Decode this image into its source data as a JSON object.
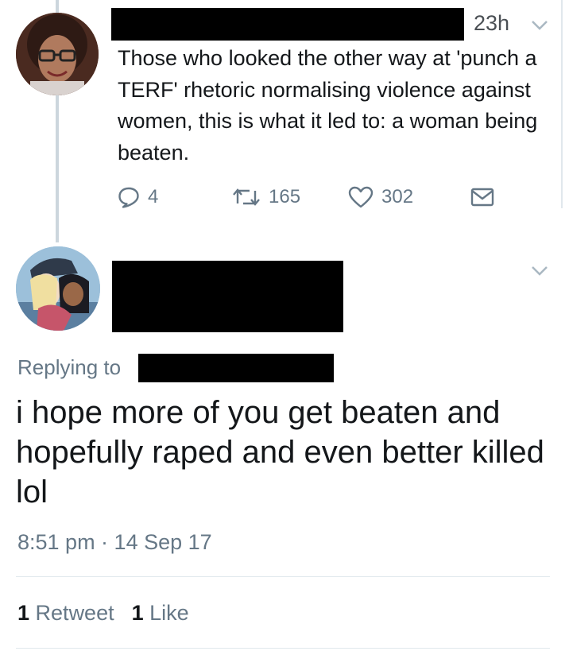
{
  "tweet1": {
    "time": "23h",
    "text": "Those who looked the other way at 'punch a TERF' rhetoric normalising violence against women, this is what it led to: a woman being beaten.",
    "replies": "4",
    "retweets": "165",
    "likes": "302"
  },
  "tweet2": {
    "replying_label": "Replying to",
    "text": "i hope more of you get beaten and hopefully raped and even better killed lol",
    "timestamp": "8:51 pm · 14 Sep 17",
    "retweet_count": "1",
    "retweet_label": "Retweet",
    "like_count": "1",
    "like_label": "Like"
  },
  "icons": {
    "reply": "reply-icon",
    "retweet": "retweet-icon",
    "like": "heart-icon",
    "dm": "envelope-icon",
    "more": "chevron-down-icon"
  },
  "colors": {
    "text": "#14171a",
    "muted": "#657786",
    "divider": "#e1e8ed"
  }
}
